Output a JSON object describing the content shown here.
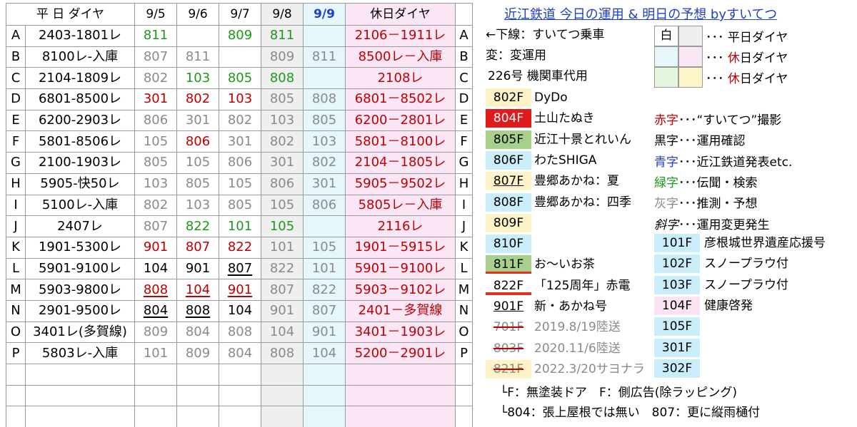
{
  "page_title": "近江鉄道 今日の運用 & 明日の予想 byすいてつ",
  "grid": {
    "headers": {
      "weekday": "平 日 ダイヤ",
      "d1": "9/5",
      "d2": "9/6",
      "d3": "9/7",
      "d4": "9/8",
      "d5": "9/9",
      "holiday": "休日ダイヤ"
    },
    "rows": [
      {
        "l": "A",
        "w": "2403-1801レ",
        "v": [
          [
            "811",
            "green"
          ],
          [
            "",
            ""
          ],
          [
            "809",
            "green"
          ],
          [
            "811",
            "green"
          ],
          [
            "",
            ""
          ]
        ],
        "h": "2106－1911レ",
        "hc": "red"
      },
      {
        "l": "B",
        "w": "8100レ-入庫",
        "v": [
          [
            "807",
            "gray"
          ],
          [
            "811",
            "gray"
          ],
          [
            "",
            ""
          ],
          [
            "809",
            "gray"
          ],
          [
            "811",
            "gray"
          ]
        ],
        "h": "8500レ－入庫",
        "hc": "red"
      },
      {
        "l": "C",
        "w": "2104-1809レ",
        "v": [
          [
            "802",
            "gray"
          ],
          [
            "103",
            "green"
          ],
          [
            "805",
            "green"
          ],
          [
            "808",
            "green"
          ],
          [
            "",
            ""
          ]
        ],
        "h": "2108レ",
        "hc": "red"
      },
      {
        "l": "D",
        "w": "6801-8500レ",
        "v": [
          [
            "301",
            "red"
          ],
          [
            "802",
            "red"
          ],
          [
            "103",
            "red"
          ],
          [
            "805",
            "gray"
          ],
          [
            "808",
            "gray"
          ]
        ],
        "h": "6801－8502レ",
        "hc": "red"
      },
      {
        "l": "E",
        "w": "6200-2903レ",
        "v": [
          [
            "806",
            "gray"
          ],
          [
            "301",
            "gray"
          ],
          [
            "802",
            "gray"
          ],
          [
            "103",
            "gray"
          ],
          [
            "805",
            "gray"
          ]
        ],
        "h": "6200－2801レ",
        "hc": "red"
      },
      {
        "l": "F",
        "w": "5801-8506レ",
        "v": [
          [
            "105",
            "gray"
          ],
          [
            "806",
            "red"
          ],
          [
            "301",
            "gray"
          ],
          [
            "802",
            "gray"
          ],
          [
            "103",
            "gray"
          ]
        ],
        "h": "5801－8100レ",
        "hc": "red"
      },
      {
        "l": "G",
        "w": "2100-1903レ",
        "v": [
          [
            "805",
            "gray"
          ],
          [
            "105",
            "gray"
          ],
          [
            "806",
            "gray"
          ],
          [
            "301",
            "gray"
          ],
          [
            "802",
            "gray"
          ]
        ],
        "h": "2104－1805レ",
        "hc": "red"
      },
      {
        "l": "H",
        "w": "5905-快50レ",
        "v": [
          [
            "103",
            "gray"
          ],
          [
            "805",
            "gray"
          ],
          [
            "105",
            "gray"
          ],
          [
            "806",
            "gray"
          ],
          [
            "301",
            "gray"
          ]
        ],
        "h": "5905－9502レ",
        "hc": "red"
      },
      {
        "l": "I",
        "w": "5100レ-入庫",
        "v": [
          [
            "802",
            "gray"
          ],
          [
            "103",
            "gray"
          ],
          [
            "805",
            "gray"
          ],
          [
            "105",
            "gray"
          ],
          [
            "806",
            "gray"
          ]
        ],
        "h": "5805レ－入庫",
        "hc": "red"
      },
      {
        "l": "J",
        "w": "2407レ",
        "v": [
          [
            "807",
            "gray"
          ],
          [
            "822",
            "green"
          ],
          [
            "101",
            "green"
          ],
          [
            "105",
            "green"
          ],
          [
            "",
            ""
          ]
        ],
        "h": "2116レ",
        "hc": "red"
      },
      {
        "l": "K",
        "w": "1901-5300レ",
        "v": [
          [
            "901",
            "red"
          ],
          [
            "807",
            "red"
          ],
          [
            "822",
            "red"
          ],
          [
            "101",
            "gray"
          ],
          [
            "105",
            "gray"
          ]
        ],
        "h": "1901－5915レ",
        "hc": "red"
      },
      {
        "l": "L",
        "w": "5901-9100レ",
        "v": [
          [
            "104",
            "black"
          ],
          [
            "901",
            "black"
          ],
          [
            "807",
            "black-u"
          ],
          [
            "822",
            "gray"
          ],
          [
            "101",
            "gray"
          ]
        ],
        "h": "5901－9100レ",
        "hc": "red"
      },
      {
        "l": "M",
        "w": "5903-9800レ",
        "v": [
          [
            "808",
            "red-u"
          ],
          [
            "104",
            "red-u"
          ],
          [
            "901",
            "red-u"
          ],
          [
            "807",
            "gray"
          ],
          [
            "822",
            "gray"
          ]
        ],
        "h": "5903－9102レ",
        "hc": "red"
      },
      {
        "l": "N",
        "w": "2901-9500レ",
        "v": [
          [
            "804",
            "black-u"
          ],
          [
            "808",
            "black-u"
          ],
          [
            "104",
            "black"
          ],
          [
            "901",
            "gray"
          ],
          [
            "807",
            "gray"
          ]
        ],
        "h": "2401－多賀線",
        "hc": "red"
      },
      {
        "l": "O",
        "w": "3401レ(多賀線)",
        "v": [
          [
            "809",
            "gray"
          ],
          [
            "804",
            "gray"
          ],
          [
            "808",
            "gray"
          ],
          [
            "104",
            "gray"
          ],
          [
            "901",
            "gray"
          ]
        ],
        "h": "3401－1903レ",
        "hc": "red"
      },
      {
        "l": "P",
        "w": "5803レ-入庫",
        "v": [
          [
            "101",
            "gray"
          ],
          [
            "809",
            "gray"
          ],
          [
            "804",
            "gray"
          ],
          [
            "808",
            "gray"
          ],
          [
            "104",
            "gray"
          ]
        ],
        "h": "5200－2901レ",
        "hc": "red"
      },
      {
        "l": "",
        "w": "",
        "v": [
          [
            "",
            ""
          ],
          [
            "",
            ""
          ],
          [
            "",
            ""
          ],
          [
            "",
            ""
          ],
          [
            "",
            ""
          ]
        ],
        "h": "",
        "hc": ""
      },
      {
        "l": "",
        "w": "",
        "v": [
          [
            "",
            ""
          ],
          [
            "",
            ""
          ],
          [
            "",
            ""
          ],
          [
            "",
            ""
          ],
          [
            "",
            ""
          ]
        ],
        "h": "",
        "hc": ""
      },
      {
        "l": "",
        "w": "",
        "v": [
          [
            "",
            ""
          ],
          [
            "",
            ""
          ],
          [
            "",
            ""
          ],
          [
            "",
            ""
          ],
          [
            "",
            ""
          ]
        ],
        "h": "",
        "hc": ""
      }
    ]
  },
  "legend": {
    "line1": "←下線：すいてつ乗車",
    "line2": "変：変運用",
    "line3": "226号 機関車代用",
    "box_white": "白",
    "dots1": "･･･",
    "weekday": "平日ダイヤ",
    "holiday_a": "休",
    "holiday_b": "日ダイヤ",
    "color_key": [
      {
        "k": "赤字",
        "t": "･･･“すいてつ”撮影",
        "c": "#c00000"
      },
      {
        "k": "黒字",
        "t": "･･･運用確認",
        "c": "#000000"
      },
      {
        "k": "青字",
        "t": "･･･近江鉄道発表etc.",
        "c": "#1f3fc4"
      },
      {
        "k": "緑字",
        "t": "･･･伝聞・検索",
        "c": "#1a9a1a"
      },
      {
        "k": "灰字",
        "t": "･･･推測・予想",
        "c": "#8a8a8a"
      },
      {
        "k": "斜字",
        "t": "･･･運用変更発生",
        "c": "#000000"
      }
    ]
  },
  "cars_left": [
    {
      "num": "802F",
      "desc": "DyDo",
      "bg": "#fdf3c6"
    },
    {
      "num": "804F",
      "desc": "土山たぬき",
      "bg": "#e01b1b"
    },
    {
      "num": "805F",
      "desc": "近江十景とれいん",
      "bg": "#a8d08d"
    },
    {
      "num": "806F",
      "desc": "わたSHIGA",
      "bg": "#c9eefa"
    },
    {
      "num": "807F",
      "desc": "豊郷あかね：夏",
      "bg": "#fdf3c6"
    },
    {
      "num": "808F",
      "desc": "豊郷あかね：四季",
      "bg": "#c9eefa"
    },
    {
      "num": "809F",
      "desc": "",
      "bg": "#fdf3c6"
    },
    {
      "num": "810F",
      "desc": "",
      "bg": "#c9eefa"
    },
    {
      "num": "811F",
      "desc": "お～いお茶",
      "bg": "#a8d08d"
    },
    {
      "num": "822F",
      "desc": "「125周年」赤電",
      "bg": "#ffffff"
    },
    {
      "num": "901F",
      "desc": "新・あかね号",
      "bg": "#ffffff"
    },
    {
      "num": "701F",
      "desc": "2019.8/19陸送",
      "bg": "#ffffff"
    },
    {
      "num": "803F",
      "desc": "2020.11/6陸送",
      "bg": "#ffffff"
    },
    {
      "num": "821F",
      "desc": "2022.3/20サヨナラ",
      "bg": "#fdf3c6"
    }
  ],
  "cars_right": [
    {
      "num": "101F",
      "desc": "彦根城世界遺産応援号",
      "bg": "#c9eefa"
    },
    {
      "num": "102F",
      "desc": "スノープラウ付",
      "bg": "#c9eefa"
    },
    {
      "num": "103F",
      "desc": "スノープラウ付",
      "bg": "#c9eefa"
    },
    {
      "num": "104F",
      "desc": "健康啓発",
      "bg": "#fbe3f4"
    },
    {
      "num": "105F",
      "desc": "",
      "bg": "#c9eefa"
    },
    {
      "num": "301F",
      "desc": "",
      "bg": "#c9eefa"
    },
    {
      "num": "302F",
      "desc": "",
      "bg": "#c9eefa"
    }
  ],
  "notes": {
    "n1": "└F：無塗装ドア　F：側広告(除ラッピング)",
    "n2": "└804：張上屋根では無い　807：更に縦雨樋付"
  }
}
